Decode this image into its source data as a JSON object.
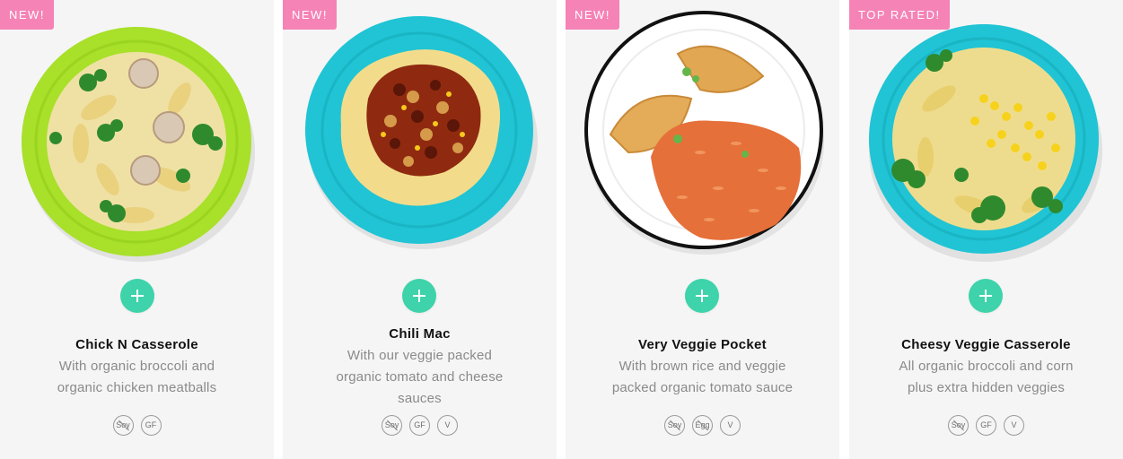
{
  "colors": {
    "badge": "#f583b6",
    "add_button": "#3ed3aa",
    "card_bg": "#f5f5f5",
    "title": "#111111",
    "description": "#8a8a8a"
  },
  "add_icon": "plus-icon",
  "cards": [
    {
      "badge": "NEW!",
      "title": "Chick N Casserole",
      "description": [
        "With organic broccoli and",
        "organic chicken meatballs"
      ],
      "tags": [
        "Soy",
        "GF"
      ],
      "plate_color": "#a8e02a"
    },
    {
      "badge": "NEW!",
      "title": "Chili Mac",
      "description": [
        "With our veggie packed",
        "organic tomato and cheese",
        "sauces"
      ],
      "tags": [
        "Soy",
        "GF",
        "V"
      ],
      "plate_color": "#20c4d4"
    },
    {
      "badge": "NEW!",
      "title": "Very Veggie Pocket",
      "description": [
        "With brown rice and veggie",
        "packed organic tomato sauce"
      ],
      "tags": [
        "Soy",
        "Egg",
        "V"
      ],
      "plate_color": "#ffffff"
    },
    {
      "badge": "TOP RATED!",
      "title": "Cheesy Veggie Casserole",
      "description": [
        "All organic broccoli and corn",
        "plus extra hidden veggies"
      ],
      "tags": [
        "Soy",
        "GF",
        "V"
      ],
      "plate_color": "#20c4d4"
    }
  ]
}
